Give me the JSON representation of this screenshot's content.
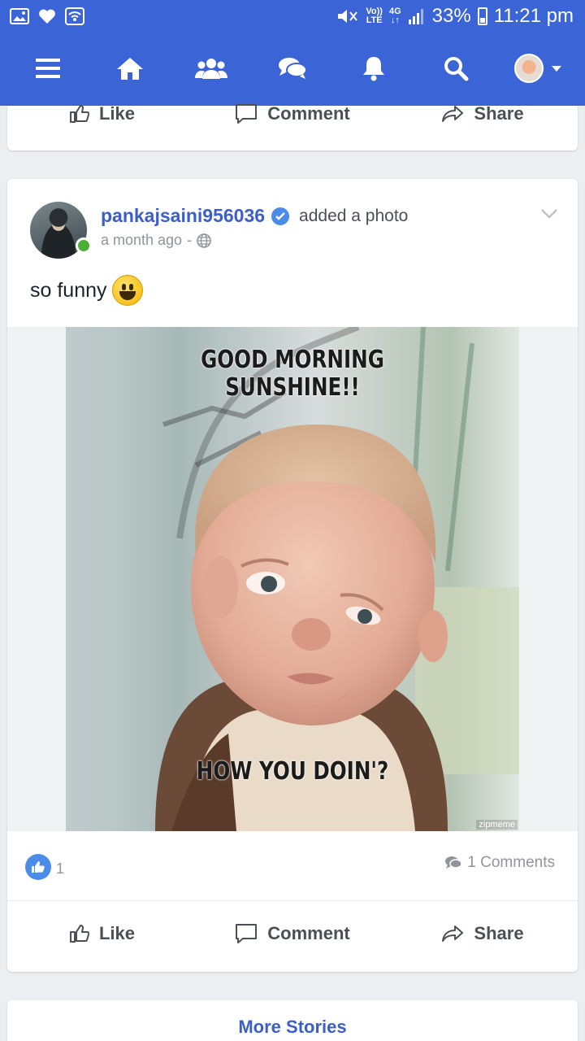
{
  "status_bar": {
    "volte_top": "Vo))",
    "volte_bottom": "LTE",
    "network": "4G",
    "battery": "33%",
    "time": "11:21 pm"
  },
  "nav": {
    "items": [
      "menu-icon",
      "home-icon",
      "friends-icon",
      "messages-icon",
      "notifications-icon",
      "search-icon",
      "profile-avatar"
    ],
    "accent": "#3b64d6"
  },
  "actions": {
    "like": "Like",
    "comment": "Comment",
    "share": "Share"
  },
  "post": {
    "author": "pankajsaini956036",
    "action_text": "added a photo",
    "time": "a month ago",
    "separator": "-",
    "text": "so funny",
    "image_caption_top_line1": "GOOD MORNING",
    "image_caption_top_line2": "SUNSHINE!!",
    "image_caption_bottom": "HOW YOU DOIN'?",
    "image_watermark": "zipmeme",
    "likes": "1",
    "comments": "1 Comments"
  },
  "footer": {
    "more_stories": "More Stories"
  }
}
